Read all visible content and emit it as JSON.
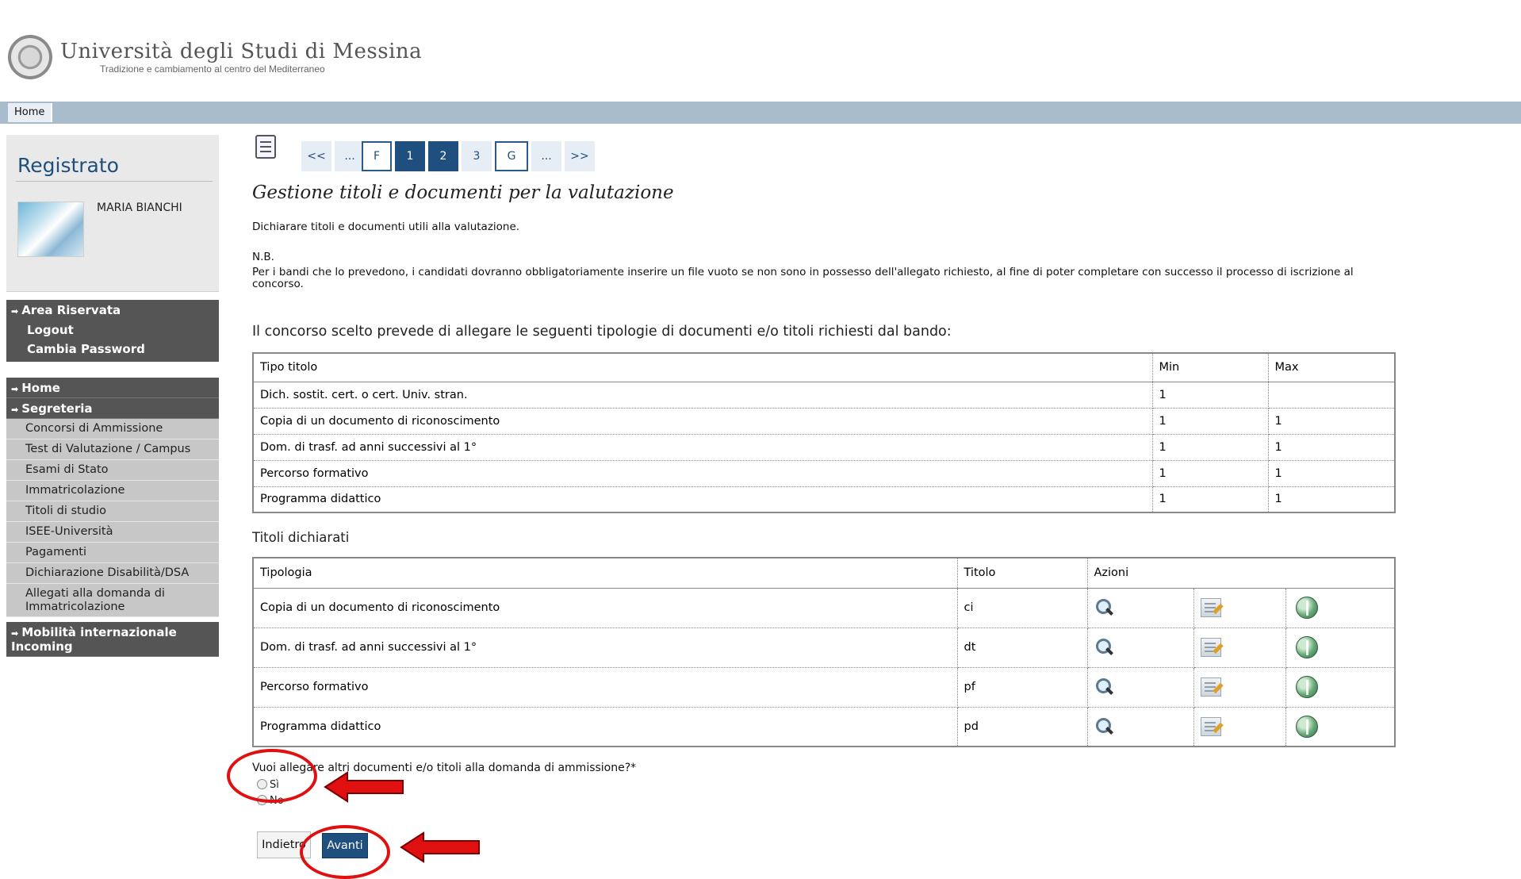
{
  "header": {
    "university_name": "Università degli Studi di Messina",
    "motto": "Tradizione e cambiamento al centro del Mediterraneo"
  },
  "topbar": {
    "home_label": "Home"
  },
  "sidebar": {
    "user_box_title": "Registrato",
    "user_name": "MARIA BIANCHI",
    "area_riservata": {
      "label": "Area Riservata",
      "links": [
        "Logout",
        "Cambia Password"
      ]
    },
    "menu": {
      "home": "Home",
      "segreteria": "Segreteria",
      "segreteria_items": [
        "Concorsi di Ammissione",
        "Test di Valutazione / Campus",
        "Esami di Stato",
        "Immatricolazione",
        "Titoli di studio",
        "ISEE-Università",
        "Pagamenti",
        "Dichiarazione Disabilità/DSA",
        "Allegati alla domanda di Immatricolazione"
      ],
      "mobilita": "Mobilità internazionale Incoming"
    }
  },
  "wizard": {
    "steps": [
      "<<",
      "...",
      "F",
      "1",
      "2",
      "3",
      "G",
      "...",
      ">>"
    ],
    "active_step": "2"
  },
  "main": {
    "title": "Gestione titoli e documenti per la valutazione",
    "intro": "Dichiarare titoli e documenti utili alla valutazione.",
    "nb_label": "N.B.",
    "nb_text": "Per i bandi che lo prevedono, i candidati dovranno obbligatoriamente inserire un file vuoto se non sono in possesso dell'allegato richiesto, al fine di poter completare con successo il processo di iscrizione al concorso.",
    "section_heading": "Il concorso scelto prevede di allegare le seguenti tipologie di documenti e/o titoli richiesti dal bando:"
  },
  "requirements_table": {
    "headers": [
      "Tipo titolo",
      "Min",
      "Max"
    ],
    "rows": [
      [
        "Dich. sostit. cert. o cert. Univ. stran.",
        "1",
        ""
      ],
      [
        "Copia di un documento di riconoscimento",
        "1",
        "1"
      ],
      [
        "Dom. di trasf. ad anni successivi al 1°",
        "1",
        "1"
      ],
      [
        "Percorso formativo",
        "1",
        "1"
      ],
      [
        "Programma didattico",
        "1",
        "1"
      ]
    ]
  },
  "declared": {
    "label": "Titoli dichiarati",
    "headers": [
      "Tipologia",
      "Titolo",
      "Azioni"
    ],
    "rows": [
      [
        "Copia di un documento di riconoscimento",
        "ci"
      ],
      [
        "Dom. di trasf. ad anni successivi al 1°",
        "dt"
      ],
      [
        "Percorso formativo",
        "pf"
      ],
      [
        "Programma didattico",
        "pd"
      ]
    ],
    "action_icons": [
      "magnifier-icon",
      "edit-icon",
      "delete-icon"
    ]
  },
  "question": {
    "text": "Vuoi allegare altri documenti e/o titoli alla domanda di ammissione?*",
    "options": [
      "Sì",
      "No"
    ]
  },
  "buttons": {
    "back": "Indietro",
    "next": "Avanti"
  },
  "colors": {
    "brand_blue": "#1f4f7f",
    "topbar": "#a8bccb",
    "menu_dark": "#555555",
    "menu_light": "#c7c7c7",
    "annotation_red": "#e01010"
  }
}
